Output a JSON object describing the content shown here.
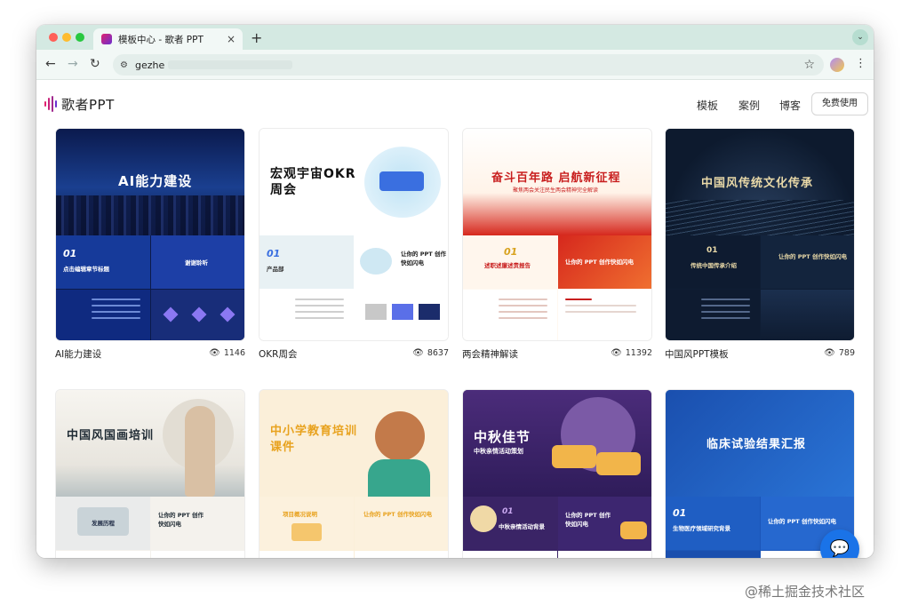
{
  "browser": {
    "tab_title": "模板中心 - 歌者 PPT",
    "tab_close": "×",
    "new_tab": "+",
    "url": "gezhe",
    "back": "←",
    "forward": "→",
    "reload": "↻",
    "site_info_icon": "⚙",
    "star": "☆",
    "menu": "⋮",
    "ext": "⌄"
  },
  "site": {
    "logo": "歌者PPT",
    "nav": [
      "模板",
      "案例",
      "博客"
    ],
    "cta": "免费使用"
  },
  "cards": [
    {
      "name": "AI能力建设",
      "views": "1146",
      "thumb_title": "AI能力建设",
      "cell_a": "01",
      "cell_a_sub": "点击编辑章节标题",
      "cell_b": "谢谢聆听"
    },
    {
      "name": "OKR周会",
      "views": "8637",
      "thumb_title": "宏观宇宙OKR周会",
      "cell_a": "01",
      "cell_a_sub": "产品部",
      "cell_b": "让你的 PPT 创作快如闪电"
    },
    {
      "name": "两会精神解读",
      "views": "11392",
      "thumb_title": "奋斗百年路 启航新征程",
      "thumb_sub": "聚焦两会关注民生两会精神完全解读",
      "cell_a": "01",
      "cell_a_sub": "述职述廉述责报告",
      "cell_b": "让你的 PPT 创作快如闪电"
    },
    {
      "name": "中国风PPT模板",
      "views": "789",
      "thumb_title": "中国风传统文化传承",
      "cell_a": "01",
      "cell_a_sub": "传统中国传承介绍",
      "cell_b": "让你的 PPT 创作快如闪电"
    },
    {
      "name": "",
      "views": "",
      "thumb_title": "中国风国画培训",
      "cell_a": "发展历程",
      "cell_b": "让你的 PPT 创作快如闪电"
    },
    {
      "name": "",
      "views": "",
      "thumb_title": "中小学教育培训课件",
      "cell_a": "项目概况说明",
      "cell_b": "让你的 PPT 创作快如闪电"
    },
    {
      "name": "",
      "views": "",
      "thumb_title": "中秋佳节",
      "thumb_sub": "中秋亲情活动策划",
      "cell_a": "01",
      "cell_a_sub": "中秋亲情活动背景",
      "cell_b": "让你的 PPT 创作快如闪电"
    },
    {
      "name": "",
      "views": "",
      "thumb_title": "临床试验结果汇报",
      "cell_a": "01",
      "cell_a_sub": "生物医疗领域研究背景",
      "cell_b": "让你的 PPT 创作快如闪电"
    }
  ],
  "eye_icon": "👁",
  "chat_icon": "💬",
  "watermark": "@稀土掘金技术社区",
  "colors": {
    "accent": "#1a73e8",
    "chrome": "#d4e9e2"
  }
}
